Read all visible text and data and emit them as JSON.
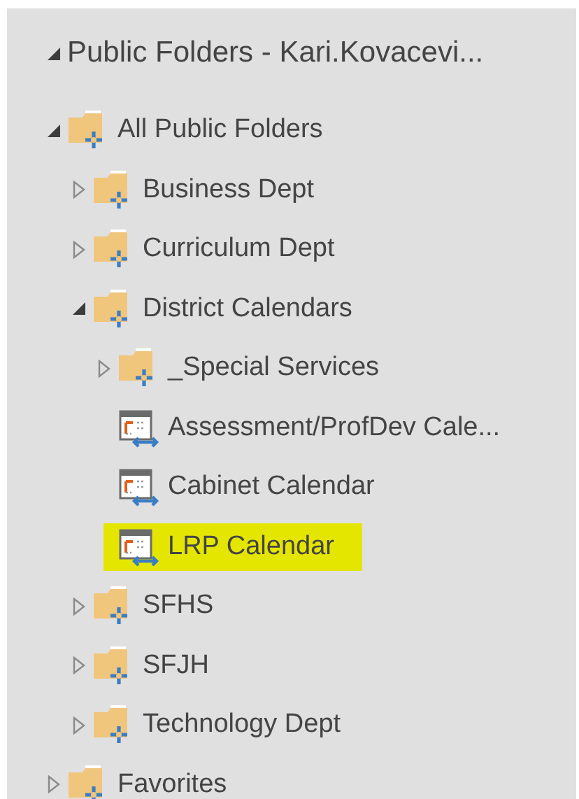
{
  "tree": [
    {
      "kind": "account",
      "label": "Public Folders - Kari.Kovacevi...",
      "expanded": true,
      "children": [
        {
          "kind": "folder",
          "label": "All Public Folders",
          "expanded": true,
          "children": [
            {
              "kind": "folder",
              "label": "Business Dept",
              "expanded": false
            },
            {
              "kind": "folder",
              "label": "Curriculum Dept",
              "expanded": false
            },
            {
              "kind": "folder",
              "label": "District Calendars",
              "expanded": true,
              "children": [
                {
                  "kind": "folder",
                  "label": "_Special Services",
                  "expanded": false
                },
                {
                  "kind": "calendar",
                  "label": "Assessment/ProfDev Cale...",
                  "highlighted": false
                },
                {
                  "kind": "calendar",
                  "label": "Cabinet Calendar",
                  "highlighted": false
                },
                {
                  "kind": "calendar",
                  "label": "LRP Calendar",
                  "highlighted": true
                }
              ]
            },
            {
              "kind": "folder",
              "label": "SFHS",
              "expanded": false
            },
            {
              "kind": "folder",
              "label": "SFJH",
              "expanded": false
            },
            {
              "kind": "folder",
              "label": "Technology Dept",
              "expanded": false
            }
          ]
        },
        {
          "kind": "folder",
          "label": "Favorites",
          "expanded": false
        }
      ]
    }
  ]
}
